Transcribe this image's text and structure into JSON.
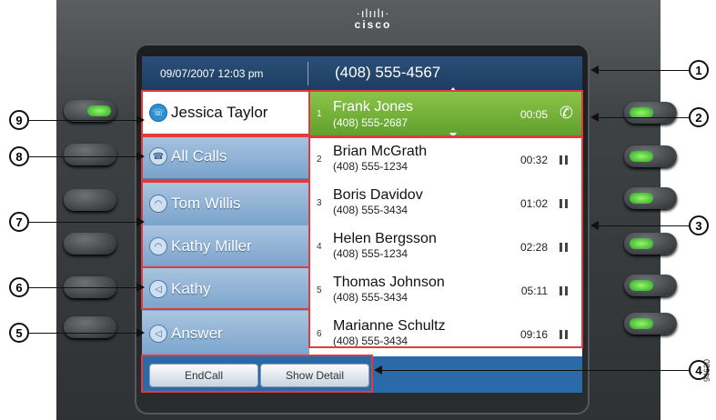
{
  "brand": {
    "logo_bars": "·ılıılı·",
    "logo_word": "cisco"
  },
  "header": {
    "datetime": "09/07/2007 12:03 pm",
    "number": "(408) 555-4567"
  },
  "lines": [
    {
      "label": "Jessica Taylor",
      "icon": "line-phone-icon",
      "selected": true
    },
    {
      "label": "All Calls",
      "icon": "all-calls-icon"
    },
    {
      "label": "Tom Willis",
      "icon": "handset-icon"
    },
    {
      "label": "Kathy Miller",
      "icon": "handset-icon"
    },
    {
      "label": "Kathy",
      "icon": "speed-dial-icon"
    },
    {
      "label": "Answer",
      "icon": "speed-dial-icon"
    }
  ],
  "calls": [
    {
      "index": "1",
      "name": "Frank Jones",
      "number": "(408) 555-2687",
      "time": "00:05",
      "state": "active"
    },
    {
      "index": "2",
      "name": "Brian McGrath",
      "number": "(408) 555-1234",
      "time": "00:32",
      "state": "hold"
    },
    {
      "index": "3",
      "name": "Boris Davidov",
      "number": "(408) 555-3434",
      "time": "01:02",
      "state": "hold"
    },
    {
      "index": "4",
      "name": "Helen Bergsson",
      "number": "(408) 555-1234",
      "time": "02:28",
      "state": "hold"
    },
    {
      "index": "5",
      "name": "Thomas Johnson",
      "number": "(408) 555-3434",
      "time": "05:11",
      "state": "hold"
    },
    {
      "index": "6",
      "name": "Marianne Schultz",
      "number": "(408) 555-3434",
      "time": "09:16",
      "state": "hold"
    }
  ],
  "softkeys": {
    "endcall": "EndCall",
    "show_detail": "Show Detail"
  },
  "callouts": [
    "1",
    "2",
    "3",
    "4",
    "5",
    "6",
    "7",
    "8",
    "9"
  ],
  "figure_code": "94630",
  "colors": {
    "active_call": "#6aaf34",
    "highlight": "#e23b3b",
    "screen": "#2a6aa8"
  }
}
